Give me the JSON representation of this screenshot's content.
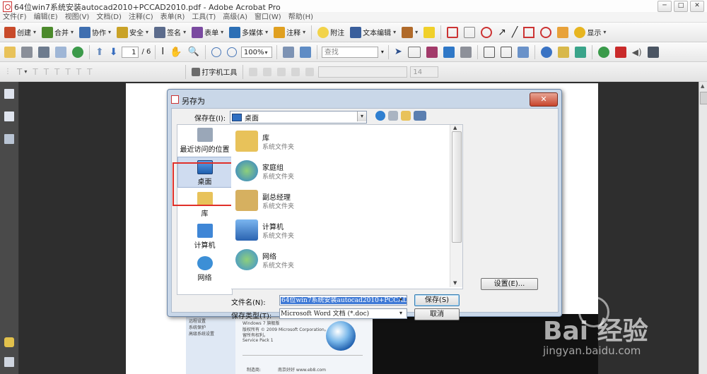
{
  "window": {
    "title": "64位win7系统安装autocad2010+PCCAD2010.pdf - Adobe Acrobat Pro",
    "min": "─",
    "max": "□",
    "close": "✕"
  },
  "menu": [
    "文件(F)",
    "编辑(E)",
    "视图(V)",
    "文档(D)",
    "注释(C)",
    "表单(R)",
    "工具(T)",
    "高级(A)",
    "窗口(W)",
    "帮助(H)"
  ],
  "toolbar1": [
    {
      "label": "创建",
      "icon": "create-icon",
      "color": "#c84a2a"
    },
    {
      "label": "合并",
      "icon": "combine-icon",
      "color": "#4c8a2c"
    },
    {
      "label": "协作",
      "icon": "collaborate-icon",
      "color": "#3f6fb0"
    },
    {
      "label": "安全",
      "icon": "lock-icon",
      "color": "#c9a227"
    },
    {
      "label": "签名",
      "icon": "pen-icon",
      "color": "#5b6b8c"
    },
    {
      "label": "表单",
      "icon": "form-icon",
      "color": "#7a4aa0"
    },
    {
      "label": "多媒体",
      "icon": "multimedia-icon",
      "color": "#2c6fb5"
    },
    {
      "label": "注释",
      "icon": "comment-icon",
      "color": "#e0a020"
    }
  ],
  "toolbar1_right": [
    {
      "label": "附注",
      "icon": "sticky-note-icon",
      "color": "#f2d34a"
    },
    {
      "label": "文本编辑",
      "icon": "text-edit-icon",
      "color": "#3a5f9c"
    },
    {
      "label": "显示",
      "icon": "show-icon",
      "color": "#e7b520"
    }
  ],
  "nav": {
    "page_current": "1",
    "page_total": "/ 6",
    "zoom": "100%",
    "search_placeholder": "查找"
  },
  "toolbar3": {
    "typewriter": "打字机工具",
    "font_size": "14"
  },
  "dialog": {
    "title": "另存为",
    "close": "✕",
    "save_in_label": "保存在(I):",
    "save_in_value": "桌面",
    "places": [
      "最近访问的位置",
      "桌面",
      "库",
      "计算机",
      "网络"
    ],
    "files": [
      {
        "name": "库",
        "type": "系统文件夹",
        "icon": "library-folder-icon",
        "color": "#e8c25a"
      },
      {
        "name": "家庭组",
        "type": "系统文件夹",
        "icon": "homegroup-icon",
        "color": "#2f7fd0"
      },
      {
        "name": "副总经理",
        "type": "系统文件夹",
        "icon": "user-folder-icon",
        "color": "#d6b060"
      },
      {
        "name": "计算机",
        "type": "系统文件夹",
        "icon": "computer-icon",
        "color": "#3f86d6"
      },
      {
        "name": "网络",
        "type": "系统文件夹",
        "icon": "network-icon",
        "color": "#3c8fd6"
      }
    ],
    "filename_label": "文件名(N):",
    "filename_value": "64位win7系统安装autocad2010+PCCAD2010",
    "filetype_label": "保存类型(T):",
    "filetype_value": "Microsoft Word 文档 (*.doc)",
    "save_button": "保存(S)",
    "cancel_button": "取消",
    "settings_button": "设置(E)..."
  },
  "doc_preview": {
    "edition": "Windows 7 旗舰版",
    "copyright": "版权所有 © 2009 Microsoft Corporation。保",
    "rights": "留所有权利。",
    "sp": "Service Pack 1",
    "sidebar": [
      "远程设置",
      "系统保护",
      "高级系统设置"
    ],
    "footer_label": "制造商:",
    "footer_value": "南京好好 www.eb8.com"
  },
  "watermark": {
    "brand": "Bai 经验",
    "url": "jingyan.baidu.com"
  }
}
